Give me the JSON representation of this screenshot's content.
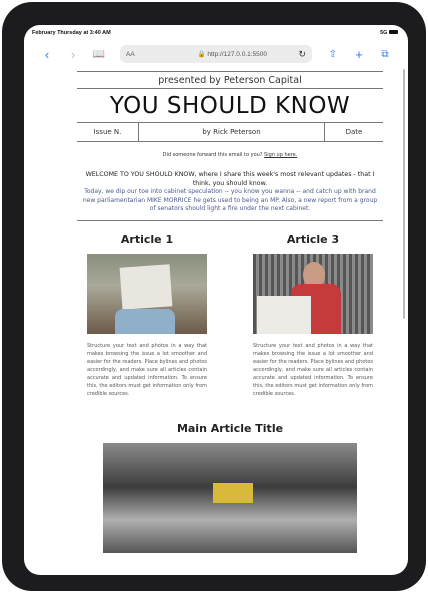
{
  "status": {
    "time": "February Thursday at 3:40 AM",
    "network": "5G"
  },
  "browser": {
    "text_size": "AA",
    "url": "http://127.0.0.1:5500"
  },
  "newsletter": {
    "presented_by": "presented by Peterson Capital",
    "title": "YOU SHOULD KNOW",
    "issue": "Issue N.",
    "byline": "by Rick Peterson",
    "date": "Date",
    "forward_text": "Did someone forward this email to you?",
    "signup_link": "Sign up here.",
    "welcome": "WELCOME TO YOU SHOULD KNOW, where I share this week's most relevant updates - that I think, you should know.",
    "intro": "Today, we dip our toe into cabinet speculation -- you know you wanna -- and catch up with brand new parliamentarian MIKE MORRICE he gets used to being an MP. Also, a new report from a group of senators should light a fire under the next cabinet.",
    "articles": [
      {
        "title": "Article 1",
        "body": "Structure your text and photos in a way that makes browsing the issue a lot smoother and easier for the readers. Place bylines and photos accordingly, and make sure all articles contain accurate and updated information. To ensure this, the editors must get information only from credible sources."
      },
      {
        "title": "Article 3",
        "body": "Structure your text and photos in a way that makes browsing the issue a lot smoother and easier for the readers. Place bylines and photos accordingly, and make sure all articles contain accurate and updated information. To ensure this, the editors must get information only from credible sources."
      }
    ],
    "main_title": "Main Article Title"
  }
}
